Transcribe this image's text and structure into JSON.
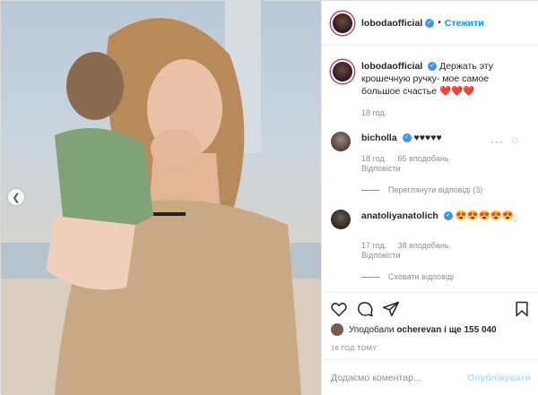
{
  "post": {
    "username": "lobodaofficial",
    "follow_label": "Стежити",
    "dot": "•",
    "caption": "Держать эту крошечную ручку- мое самое большое счастье ❤️❤️❤️",
    "caption_time": "18 год."
  },
  "comments": [
    {
      "username": "bicholla",
      "text": "♥♥♥♥♥",
      "time": "18 год.",
      "likes": "65 вподобань",
      "reply": "Відповісти",
      "replies_toggle": "Переглянути відповіді (3)"
    },
    {
      "username": "anatoliyanatolich",
      "text": "😍😍😍😍😍",
      "time": "17 год.",
      "likes": "38 вподобань",
      "reply": "Відповісти",
      "replies_toggle": "Сховати відповіді"
    }
  ],
  "likes_line": {
    "prefix": "Уподобали",
    "user": "ocherevan",
    "suffix": "і ще 155 040"
  },
  "timestamp": "18 ГОД ТОМУ",
  "add_comment": {
    "placeholder": "Додаємо коментар...",
    "publish_label": "Опублікувати"
  },
  "icons": {
    "like": "heart-icon",
    "comment": "comment-icon",
    "share": "share-icon",
    "save": "bookmark-icon"
  },
  "colors": {
    "accent": "#0095f6",
    "verified": "#3897f0",
    "heart_red": "#ed4956"
  }
}
